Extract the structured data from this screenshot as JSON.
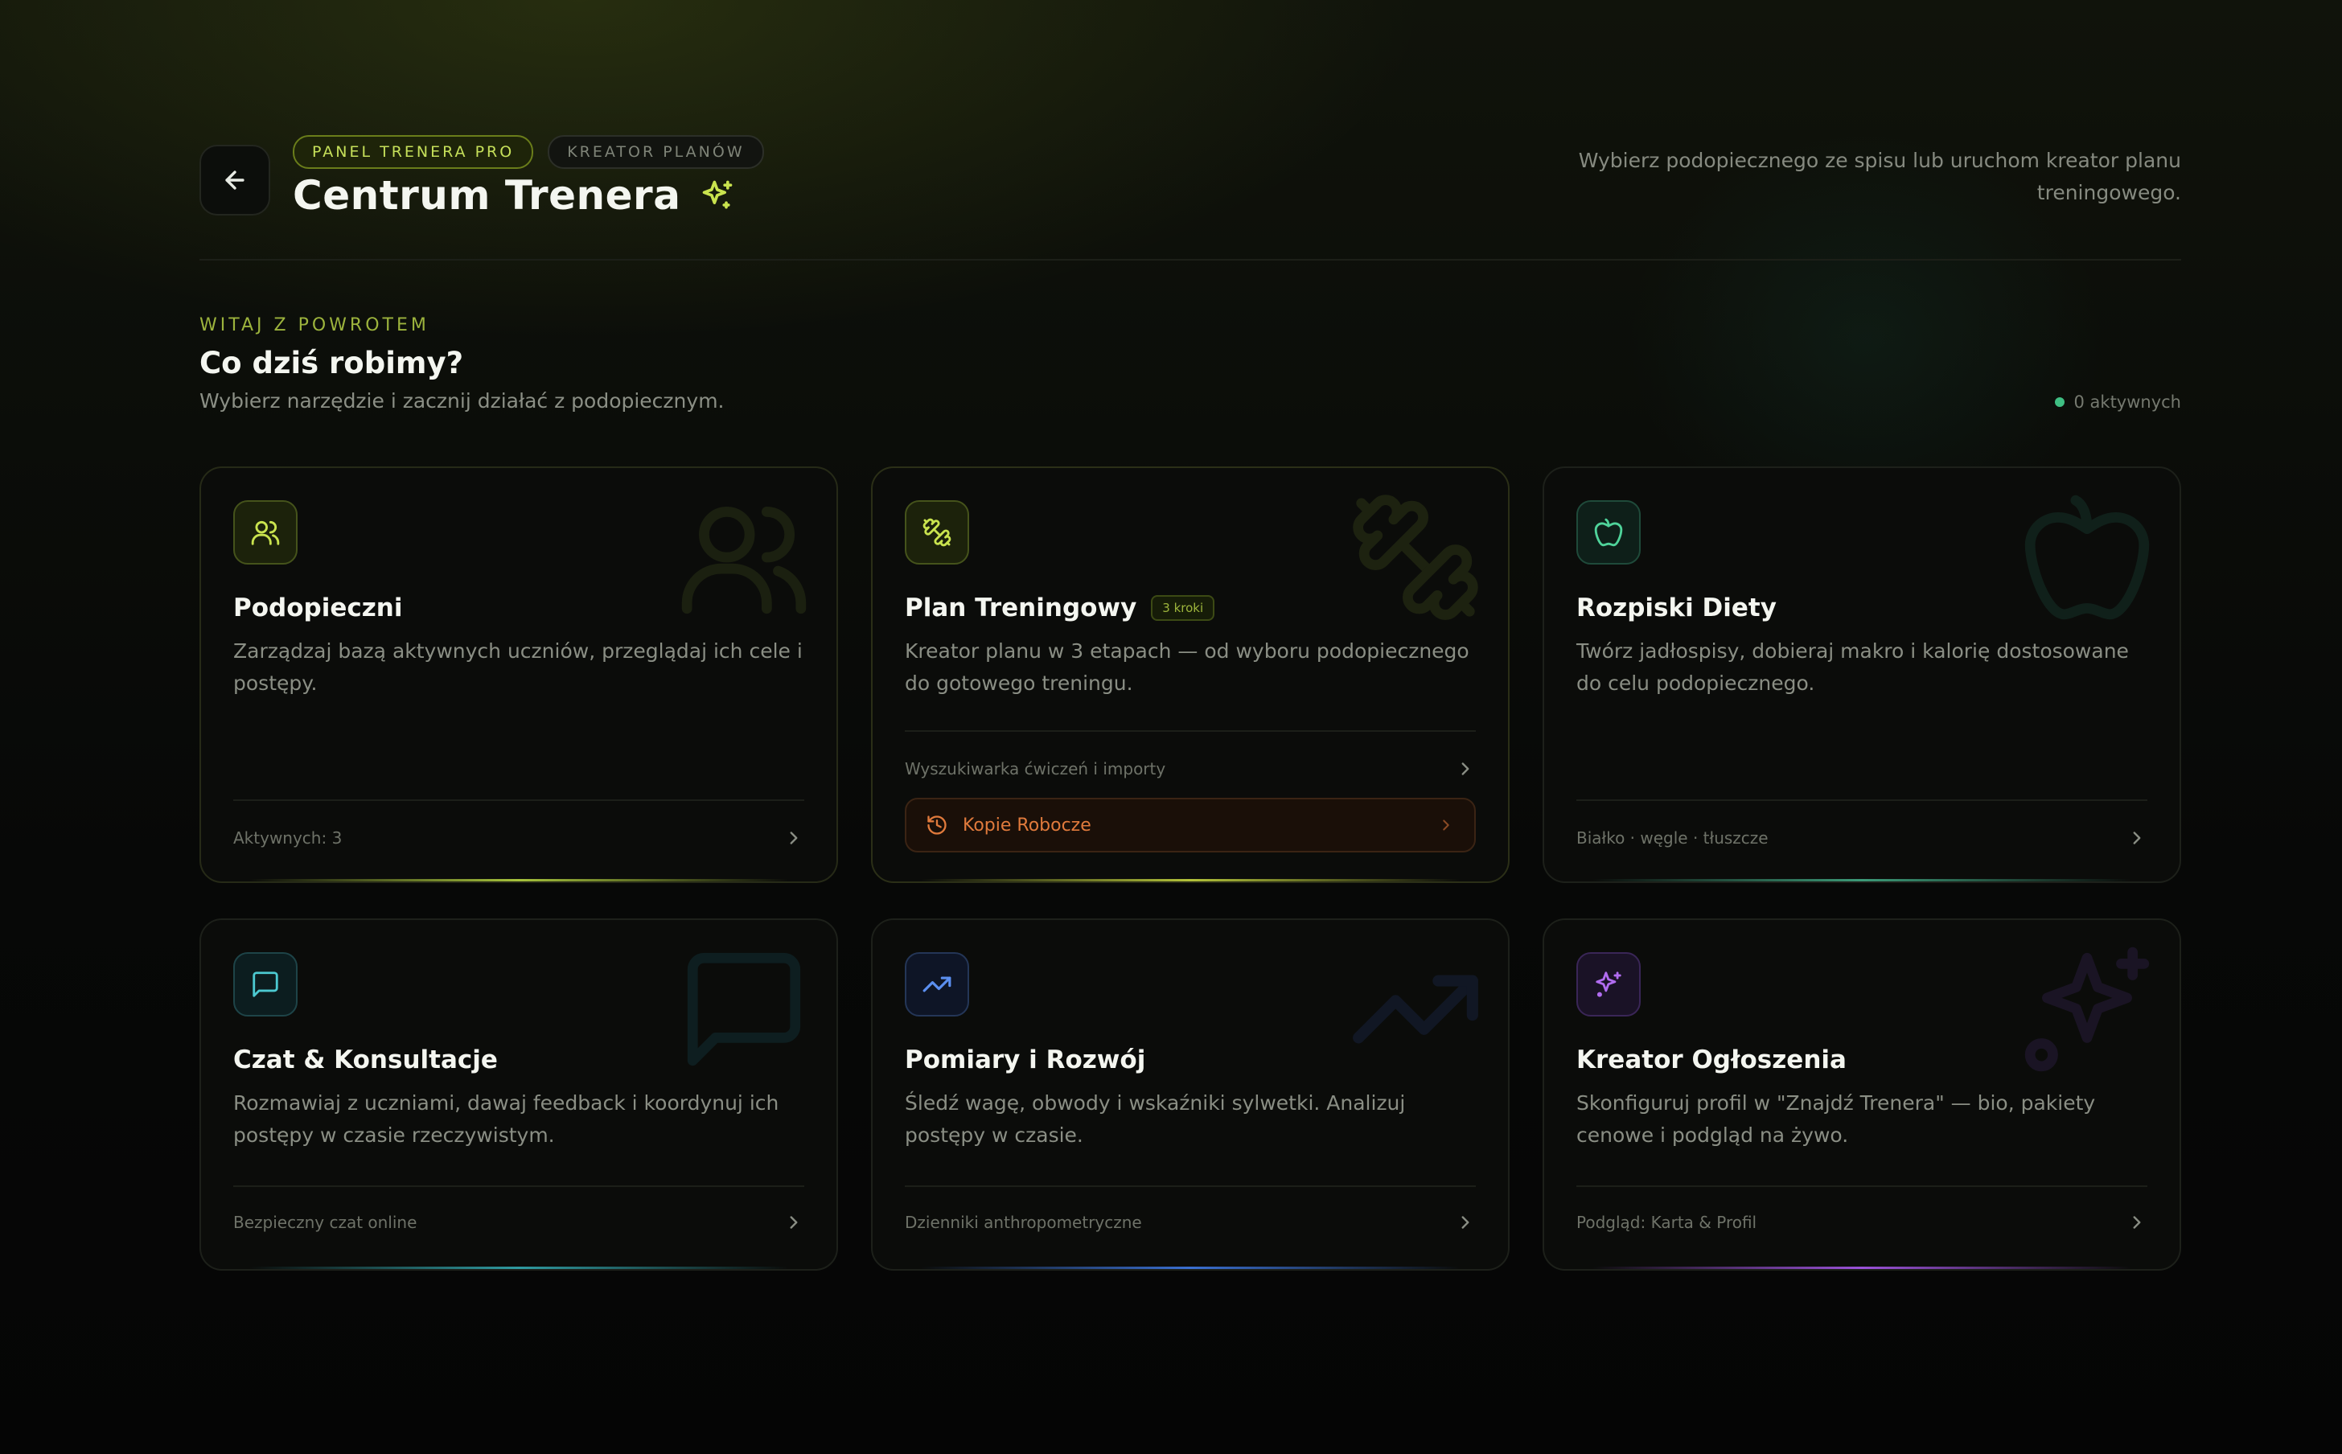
{
  "header": {
    "badge_pro": "PANEL TRENERA PRO",
    "badge_creator": "KREATOR PLANÓW",
    "title": "Centrum Trenera",
    "description": "Wybierz podopiecznego ze spisu lub uruchom kreator planu treningowego."
  },
  "welcome": {
    "kicker": "WITAJ Z POWROTEM",
    "title": "Co dziś robimy?",
    "subtitle": "Wybierz narzędzie i zacznij działać z podopiecznym.",
    "active_count": "0 aktywnych"
  },
  "cards": [
    {
      "title": "Podopieczni",
      "description": "Zarządzaj bazą aktywnych uczniów, przeglądaj ich cele i postępy.",
      "footer": "Aktywnych: 3",
      "icon": "users-icon",
      "accent": "#a6c23c"
    },
    {
      "title": "Plan Treningowy",
      "badge": "3 kroki",
      "description": "Kreator planu w 3 etapach — od wyboru podopiecznego do gotowego treningu.",
      "footer": "Wyszukiwarka ćwiczeń i importy",
      "drafts_label": "Kopie Robocze",
      "icon": "dumbbell-icon",
      "accent": "#b3c23a"
    },
    {
      "title": "Rozpiski Diety",
      "description": "Twórz jadłospisy, dobieraj makro i kalorię dostosowane do celu podopiecznego.",
      "footer": "Białko · węgle · tłuszcze",
      "icon": "apple-icon",
      "accent": "#3c9a78"
    },
    {
      "title": "Czat & Konsultacje",
      "description": "Rozmawiaj z uczniami, dawaj feedback i koordynuj ich postępy w czasie rzeczywistym.",
      "footer": "Bezpieczny czat online",
      "icon": "chat-icon",
      "accent": "#2f9aa0"
    },
    {
      "title": "Pomiary i Rozwój",
      "description": "Śledź wagę, obwody i wskaźniki sylwetki. Analizuj postępy w czasie.",
      "footer": "Dzienniki anthropometryczne",
      "icon": "trending-up-icon",
      "accent": "#3a6fd0"
    },
    {
      "title": "Kreator Ogłoszenia",
      "description": "Skonfiguruj profil w \"Znajdź Trenera\" — bio, pakiety cenowe i podgląd na żywo.",
      "footer": "Podgląd: Karta & Profil",
      "icon": "sparkles-icon",
      "accent": "#9a52d8"
    }
  ]
}
